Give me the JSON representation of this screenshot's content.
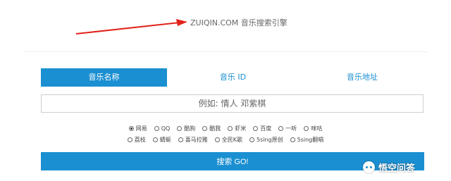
{
  "site": {
    "title": "ZUIQIN.COM 音乐搜索引擎"
  },
  "tabs": [
    {
      "label": "音乐名称",
      "active": true
    },
    {
      "label": "音乐 ID",
      "active": false
    },
    {
      "label": "音乐地址",
      "active": false
    }
  ],
  "search": {
    "placeholder": "例如: 情人 邓紫棋",
    "value": ""
  },
  "sources": {
    "row1": [
      "网易",
      "QQ",
      "酷狗",
      "酷我",
      "虾米",
      "百度",
      "一听",
      "咪咕"
    ],
    "row2": [
      "荔枝",
      "蜻蜓",
      "喜马拉雅",
      "全民K歌",
      "5sing原创",
      "5sing翻唱"
    ],
    "selected": "网易"
  },
  "go_button": {
    "label": "搜索 GO!"
  },
  "watermark": {
    "text": "悟空问答"
  },
  "colors": {
    "accent": "#1a8fd1",
    "arrow": "#e2231a"
  }
}
